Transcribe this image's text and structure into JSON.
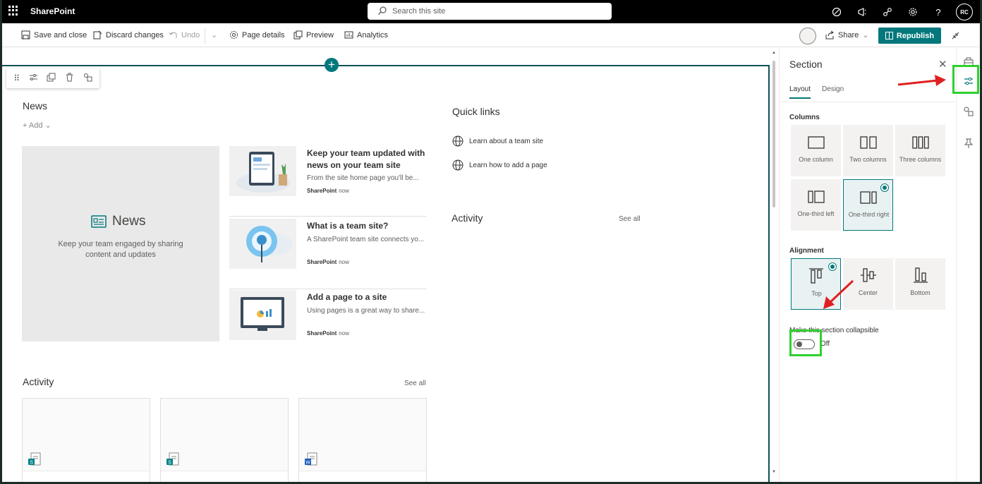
{
  "app": {
    "brand": "SharePoint",
    "user_initials": "RC"
  },
  "search": {
    "placeholder": "Search this site"
  },
  "toolbar": {
    "save_close": "Save and close",
    "discard": "Discard changes",
    "undo": "Undo",
    "page_details": "Page details",
    "preview": "Preview",
    "analytics": "Analytics",
    "share": "Share",
    "republish": "Republish"
  },
  "news": {
    "heading": "News",
    "add": "Add",
    "hero_title": "News",
    "hero_desc": "Keep your team engaged by sharing content and updates",
    "items": [
      {
        "title": "Keep your team updated with news on your team site",
        "summary": "From the site home page you'll be...",
        "author": "SharePoint",
        "time": "now"
      },
      {
        "title": "What is a team site?",
        "summary": "A SharePoint team site connects yo...",
        "author": "SharePoint",
        "time": "now"
      },
      {
        "title": "Add a page to a site",
        "summary": "Using pages is a great way to share...",
        "author": "SharePoint",
        "time": "now"
      }
    ]
  },
  "quicklinks": {
    "heading": "Quick links",
    "links": [
      "Learn about a team site",
      "Learn how to add a page"
    ]
  },
  "activity": {
    "heading": "Activity",
    "see_all": "See all"
  },
  "pane": {
    "title": "Section",
    "tabs": [
      "Layout",
      "Design"
    ],
    "columns_label": "Columns",
    "column_options": [
      "One column",
      "Two columns",
      "Three columns",
      "One-third left",
      "One-third right"
    ],
    "alignment_label": "Alignment",
    "alignment_options": [
      "Top",
      "Center",
      "Bottom"
    ],
    "collapsible_label": "Make this section collapsible",
    "toggle_state": "Off"
  },
  "colors": {
    "accent": "#03787c",
    "highlight": "#2ed12e",
    "arrow": "#e02020"
  }
}
